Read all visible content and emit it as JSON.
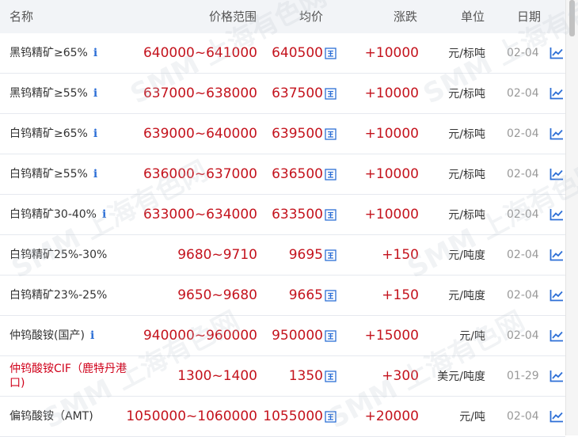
{
  "header": {
    "name": "名称",
    "range": "价格范围",
    "avg": "均价",
    "change": "涨跌",
    "unit": "单位",
    "date": "日期"
  },
  "watermark": "SMM 上海有色网",
  "colors": {
    "price_red": "#c4131d",
    "info_blue": "#2d6fd6",
    "header_bg": "#f2f4f7"
  },
  "rows": [
    {
      "name": "黑钨精矿≥65%",
      "info": "i",
      "range": "640000~641000",
      "avg": "640500",
      "change": "+10000",
      "unit": "元/标吨",
      "date": "02-04"
    },
    {
      "name": "黑钨精矿≥55%",
      "info": "i",
      "range": "637000~638000",
      "avg": "637500",
      "change": "+10000",
      "unit": "元/标吨",
      "date": "02-04"
    },
    {
      "name": "白钨精矿≥65%",
      "info": "i",
      "range": "639000~640000",
      "avg": "639500",
      "change": "+10000",
      "unit": "元/标吨",
      "date": "02-04"
    },
    {
      "name": "白钨精矿≥55%",
      "info": "i",
      "range": "636000~637000",
      "avg": "636500",
      "change": "+10000",
      "unit": "元/标吨",
      "date": "02-04"
    },
    {
      "name": "白钨精矿30-40%",
      "info": "i",
      "range": "633000~634000",
      "avg": "633500",
      "change": "+10000",
      "unit": "元/标吨",
      "date": "02-04"
    },
    {
      "name": "白钨精矿25%-30%",
      "info": "",
      "range": "9680~9710",
      "avg": "9695",
      "change": "+150",
      "unit": "元/吨度",
      "date": "02-04"
    },
    {
      "name": "白钨精矿23%-25%",
      "info": "",
      "range": "9650~9680",
      "avg": "9665",
      "change": "+150",
      "unit": "元/吨度",
      "date": "02-04"
    },
    {
      "name": "仲钨酸铵(国产)",
      "info": "i",
      "range": "940000~960000",
      "avg": "950000",
      "change": "+15000",
      "unit": "元/吨",
      "date": "02-04"
    },
    {
      "name": "仲钨酸铵CIF（鹿特丹港口)",
      "info": "",
      "range": "1300~1400",
      "avg": "1350",
      "change": "+300",
      "unit": "美元/吨度",
      "date": "01-29",
      "highlight": true
    },
    {
      "name": "偏钨酸铵（AMT)",
      "info": "",
      "range": "1050000~1060000",
      "avg": "1055000",
      "change": "+20000",
      "unit": "元/吨",
      "date": "02-04"
    }
  ]
}
